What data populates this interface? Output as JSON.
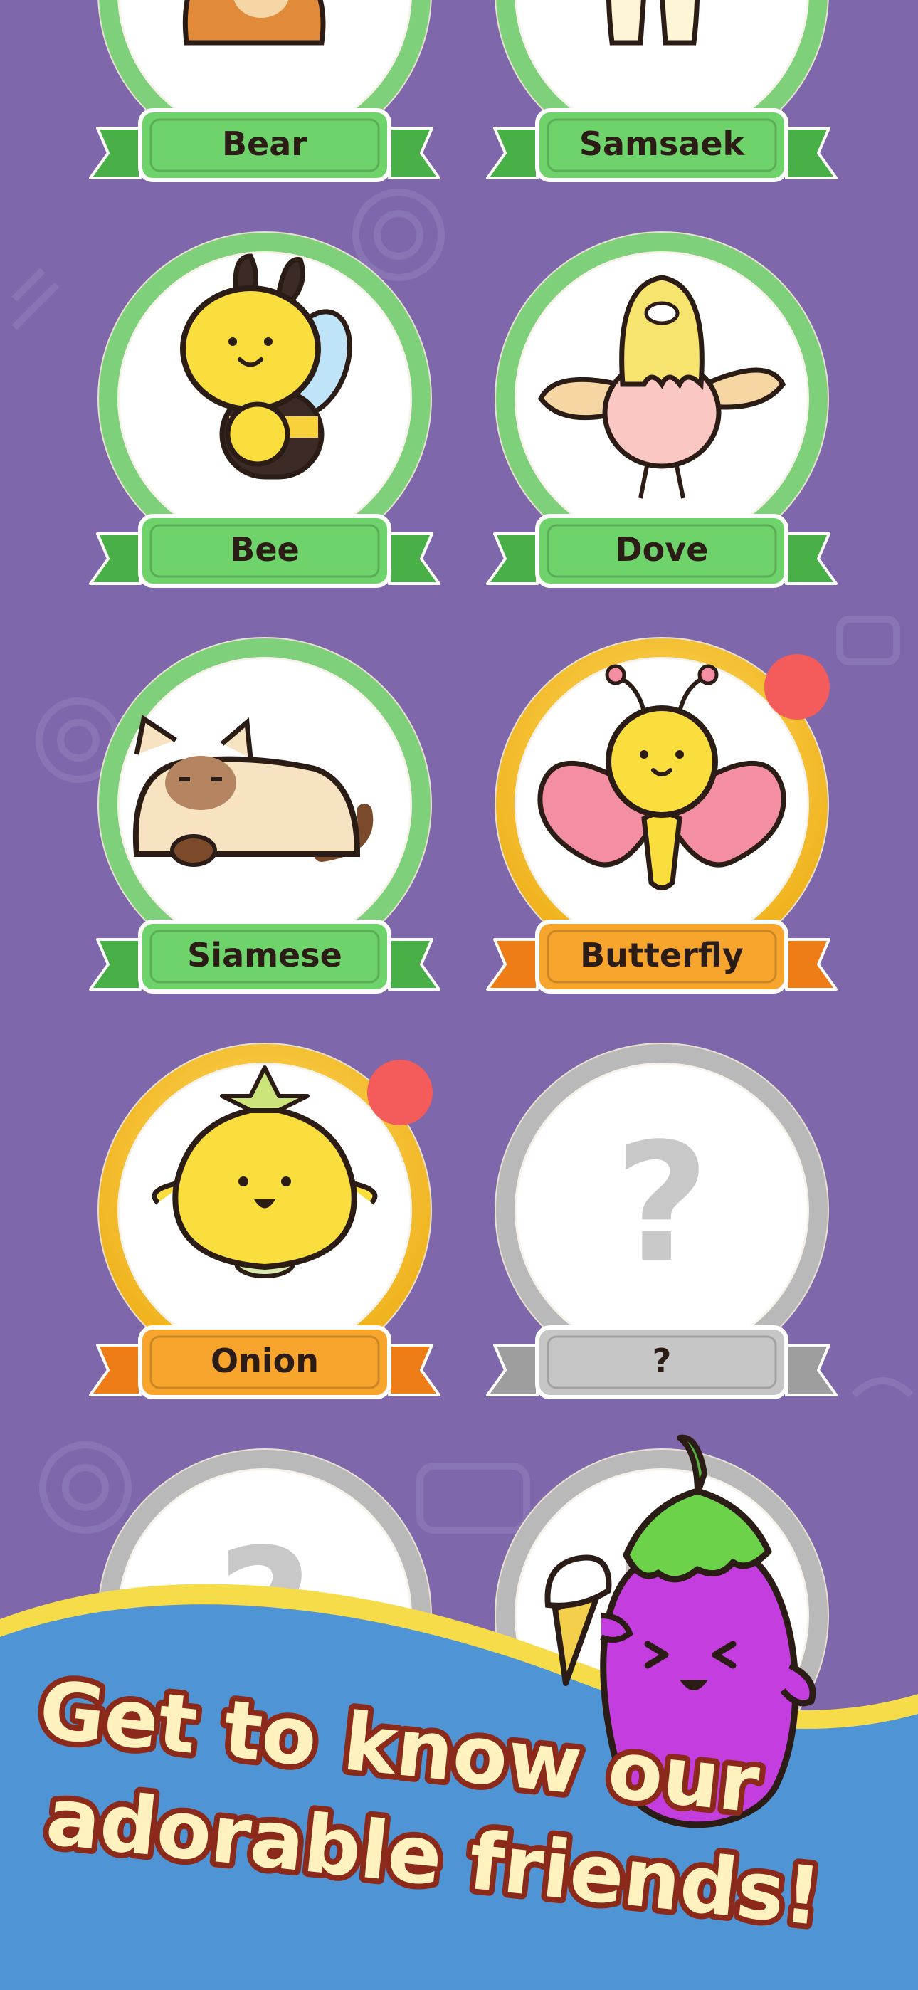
{
  "colors": {
    "background": "#7e67ab",
    "green_ring": "#7fd07a",
    "gold_ring": "#f4c02a",
    "gray_ring": "#b9b9b9",
    "green_ribbon": "#6fd36b",
    "orange_ribbon": "#f8a52e",
    "gray_ribbon": "#c6c6c6",
    "new_dot": "#f45b5b",
    "banner_blue": "#4f95d6",
    "banner_yellow": "#f7dc4a",
    "promo_text_fill": "#fff2bf",
    "promo_text_outline": "#8b2a1b"
  },
  "cards": [
    {
      "name": "Bear",
      "tier": "green",
      "badge": false,
      "icon": "bear-icon"
    },
    {
      "name": "Samsaek",
      "tier": "green",
      "badge": false,
      "icon": "samsaek-icon"
    },
    {
      "name": "Bee",
      "tier": "green",
      "badge": false,
      "icon": "bee-icon"
    },
    {
      "name": "Dove",
      "tier": "green",
      "badge": false,
      "icon": "dove-icon"
    },
    {
      "name": "Siamese",
      "tier": "green",
      "badge": false,
      "icon": "siamese-cat-icon"
    },
    {
      "name": "Butterfly",
      "tier": "gold",
      "badge": true,
      "icon": "butterfly-icon"
    },
    {
      "name": "Onion",
      "tier": "gold",
      "badge": true,
      "icon": "onion-icon"
    },
    {
      "name": "?",
      "tier": "locked",
      "badge": false,
      "icon": "question-mark-icon"
    },
    {
      "name": "?",
      "tier": "locked",
      "badge": false,
      "icon": "question-mark-icon"
    },
    {
      "name": "?",
      "tier": "locked",
      "badge": false,
      "icon": "question-mark-icon"
    }
  ],
  "promo": {
    "line1": "Get to know our",
    "line2": "adorable friends!",
    "mascot": "eggplant-mascot-icon"
  }
}
